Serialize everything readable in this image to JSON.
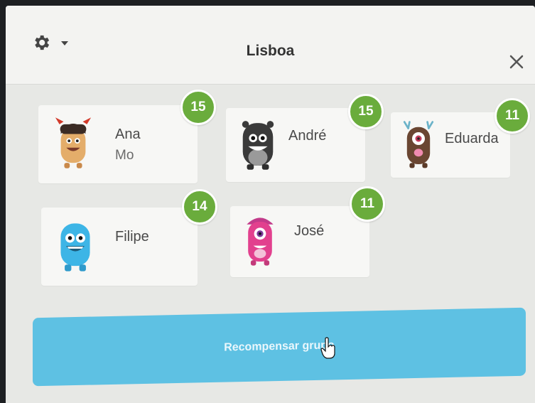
{
  "header": {
    "title": "Lisboa",
    "settings_icon": "gear-icon",
    "menu_icon": "caret-down-icon",
    "close_icon": "close-icon"
  },
  "students": [
    {
      "name": "Ana",
      "sub": "Mo",
      "points": "15",
      "avatar": "brown-horned-monster"
    },
    {
      "name": "André",
      "sub": "",
      "points": "15",
      "avatar": "dark-grey-monster"
    },
    {
      "name": "Eduarda",
      "sub": "",
      "points": "11",
      "avatar": "brown-cyclops-monster"
    },
    {
      "name": "Filipe",
      "sub": "",
      "points": "14",
      "avatar": "blue-monster"
    },
    {
      "name": "José",
      "sub": "",
      "points": "11",
      "avatar": "pink-cyclops-monster"
    }
  ],
  "reward_button": {
    "label": "Recompensar grupo"
  },
  "colors": {
    "badge": "#6aac3c",
    "button": "#5ec1e3",
    "background": "#e7e8e5"
  }
}
